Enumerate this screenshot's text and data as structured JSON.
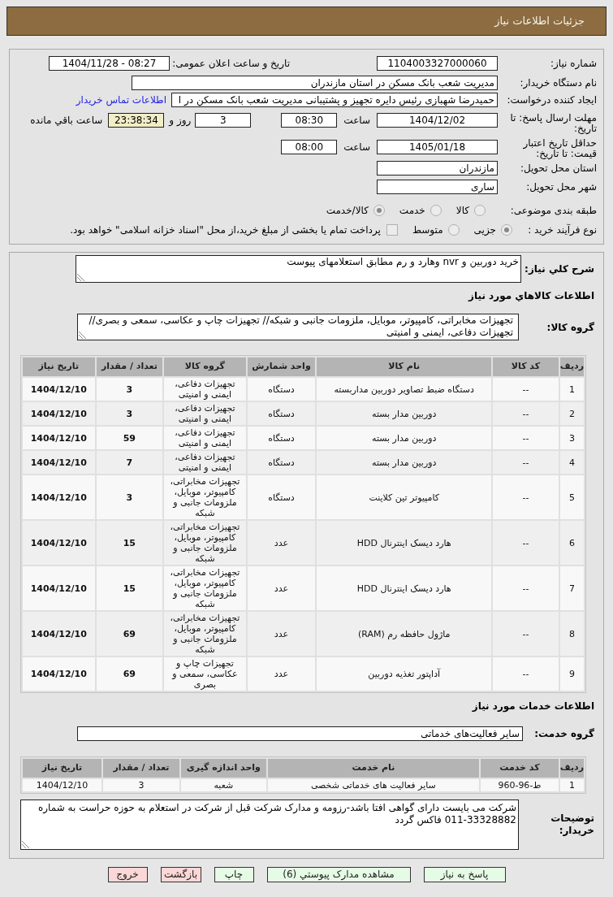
{
  "header": {
    "title": "جزئیات اطلاعات نیاز"
  },
  "details": {
    "need_number": {
      "label": "شماره نیاز:",
      "value": "1104003327000060"
    },
    "announcement": {
      "label": "تاریخ و ساعت اعلان عمومی:",
      "value": "1404/11/28 - 08:27"
    },
    "buyer_org": {
      "label": "نام دستگاه خریدار:",
      "value": "مدیریت شعب بانک مسکن در استان مازندران"
    },
    "requester": {
      "label": "ایجاد کننده درخواست:",
      "value": "حمیدرضا شهبازی رئیس دایره تجهیز و پشتیبانی  مدیریت شعب بانک مسکن در ا",
      "link": "اطلاعات تماس خریدار"
    },
    "response_deadline": {
      "label": "مهلت ارسال پاسخ: تا تاریخ:",
      "date": "1404/12/02",
      "time_label": "ساعت",
      "time": "08:30",
      "days": "3",
      "days_label": "روز و",
      "remaining": "23:38:34",
      "remaining_label": "ساعت باقي مانده"
    },
    "price_validity": {
      "label": "حداقل تاریخ اعتبار قیمت: تا تاریخ:",
      "date": "1405/01/18",
      "time_label": "ساعت",
      "time": "08:00"
    },
    "delivery_province": {
      "label": "استان محل تحویل:",
      "value": "مازندران"
    },
    "delivery_city": {
      "label": "شهر محل تحویل:",
      "value": "ساری"
    },
    "subject_category": {
      "label": "طبقه بندی موضوعی:",
      "options": [
        {
          "label": "کالا",
          "selected": false
        },
        {
          "label": "خدمت",
          "selected": false
        },
        {
          "label": "کالا/خدمت",
          "selected": true
        }
      ]
    },
    "purchase_process": {
      "label": "نوع فرآیند خرید :",
      "options": [
        {
          "label": "جزیی",
          "selected": true
        },
        {
          "label": "متوسط",
          "selected": false
        }
      ],
      "treasury_payment": {
        "label": "پرداخت تمام یا بخشی از مبلغ خرید،از محل \"اسناد خزانه اسلامی\" خواهد بود.",
        "checked": false
      }
    }
  },
  "description": {
    "label": "شرح کلي نیاز:",
    "value": "خرید دوربین و nvr وهارد و رم مطابق استعلامهای پیوست"
  },
  "goods": {
    "heading": "اطلاعات کالاهاي مورد نیاز",
    "group_label": "گروه کالا:",
    "group_value": "تجهیزات مخابراتی، کامپیوتر، موبایل، ملزومات جانبی و شبکه// تجهیزات چاپ و عکاسی، سمعی و بصری// تجهیزات دفاعی، ایمنی و امنیتی",
    "table": {
      "columns": [
        "ردیف",
        "کد کالا",
        "نام کالا",
        "واحد شمارش",
        "گروه کالا",
        "تعداد / مقدار",
        "تاریخ نیاز"
      ],
      "rows": [
        {
          "index": "1",
          "code": "--",
          "name": "دستگاه ضبط تصاویر دوربین مداربسته",
          "unit": "دستگاه",
          "group": "تجهیزات دفاعی، ایمنی و امنیتی",
          "quantity": "3",
          "date": "1404/12/10"
        },
        {
          "index": "2",
          "code": "--",
          "name": "دوربین مدار بسته",
          "unit": "دستگاه",
          "group": "تجهیزات دفاعی، ایمنی و امنیتی",
          "quantity": "3",
          "date": "1404/12/10"
        },
        {
          "index": "3",
          "code": "--",
          "name": "دوربین مدار بسته",
          "unit": "دستگاه",
          "group": "تجهیزات دفاعی، ایمنی و امنیتی",
          "quantity": "59",
          "date": "1404/12/10"
        },
        {
          "index": "4",
          "code": "--",
          "name": "دوربین مدار بسته",
          "unit": "دستگاه",
          "group": "تجهیزات دفاعی، ایمنی و امنیتی",
          "quantity": "7",
          "date": "1404/12/10"
        },
        {
          "index": "5",
          "code": "--",
          "name": "کامپیوتر تین کلاینت",
          "unit": "دستگاه",
          "group": "تجهیزات مخابراتی، کامپیوتر، موبایل، ملزومات جانبی و شبکه",
          "quantity": "3",
          "date": "1404/12/10"
        },
        {
          "index": "6",
          "code": "--",
          "name": "هارد دیسک اینترنال HDD",
          "unit": "عدد",
          "group": "تجهیزات مخابراتی، کامپیوتر، موبایل، ملزومات جانبی و شبکه",
          "quantity": "15",
          "date": "1404/12/10"
        },
        {
          "index": "7",
          "code": "--",
          "name": "هارد دیسک اینترنال HDD",
          "unit": "عدد",
          "group": "تجهیزات مخابراتی، کامپیوتر، موبایل، ملزومات جانبی و شبکه",
          "quantity": "15",
          "date": "1404/12/10"
        },
        {
          "index": "8",
          "code": "--",
          "name": "ماژول حافظه رم (RAM)",
          "unit": "عدد",
          "group": "تجهیزات مخابراتی، کامپیوتر، موبایل، ملزومات جانبی و شبکه",
          "quantity": "69",
          "date": "1404/12/10"
        },
        {
          "index": "9",
          "code": "--",
          "name": "آداپتور تغذیه دوربین",
          "unit": "عدد",
          "group": "تجهیزات چاپ و عکاسی، سمعی و بصری",
          "quantity": "69",
          "date": "1404/12/10"
        }
      ]
    }
  },
  "services": {
    "heading": "اطلاعات خدمات مورد نیاز",
    "group_label": "گروه خدمت:",
    "group_value": "سایر فعالیت‌های خدماتی",
    "table": {
      "columns": [
        "ردیف",
        "کد خدمت",
        "نام خدمت",
        "واحد اندازه گیری",
        "تعداد / مقدار",
        "تاریخ نیاز"
      ],
      "rows": [
        {
          "index": "1",
          "code": "ط-96-960",
          "name": "سایر فعالیت های خدماتی شخصی",
          "unit": "شعبه",
          "quantity": "3",
          "date": "1404/12/10"
        }
      ]
    }
  },
  "buyer_notes": {
    "label": "توضیحات خریدار:",
    "value": "شرکت می بایست دارای گواهی افتا باشد-رزومه و مدارک شرکت قبل از شرکت در استعلام به حوزه حراست به شماره 33328882-011 فاکس گردد"
  },
  "buttons": [
    {
      "label": "پاسخ به نیاز",
      "kind": "action"
    },
    {
      "label": "مشاهده مدارک پیوستي (6)",
      "kind": "action"
    },
    {
      "label": "چاپ",
      "kind": "action"
    },
    {
      "label": "بازگشت",
      "kind": "nav"
    },
    {
      "label": "خروج",
      "kind": "nav"
    }
  ]
}
